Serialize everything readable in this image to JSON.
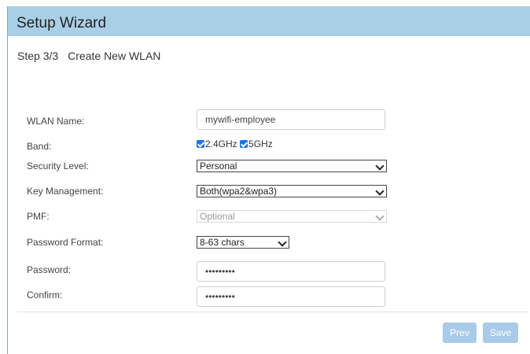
{
  "header": {
    "title": "Setup Wizard"
  },
  "step": {
    "number": "Step 3/3",
    "name": "Create New WLAN"
  },
  "form": {
    "wlan_name": {
      "label": "WLAN Name:",
      "value": "mywifi-employee"
    },
    "band": {
      "label": "Band:",
      "options": [
        "2.4GHz",
        "5GHz"
      ],
      "checked": [
        true,
        true
      ]
    },
    "security_level": {
      "label": "Security Level:",
      "value": "Personal"
    },
    "key_management": {
      "label": "Key Management:",
      "value": "Both(wpa2&wpa3)"
    },
    "pmf": {
      "label": "PMF:",
      "value": "Optional",
      "disabled": true
    },
    "password_format": {
      "label": "Password Format:",
      "value": "8-63 chars"
    },
    "password": {
      "label": "Password:",
      "value": "•••••••••"
    },
    "confirm": {
      "label": "Confirm:",
      "value": "•••••••••"
    }
  },
  "buttons": {
    "prev": "Prev",
    "save": "Save"
  },
  "colors": {
    "header_bg": "#a8cfe6",
    "button_bg": "#a9cbe8",
    "checkbox": "#1a73e8"
  }
}
